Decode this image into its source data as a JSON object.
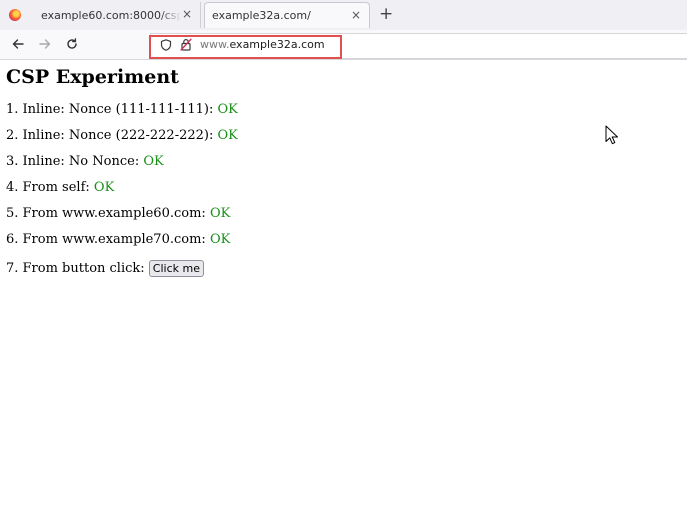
{
  "browser": {
    "tabs": [
      {
        "title": "example60.com:8000/cspte",
        "close_label": "×",
        "active": false
      },
      {
        "title": "example32a.com/",
        "close_label": "×",
        "active": true
      }
    ],
    "new_tab_label": "+",
    "address_bar": {
      "url_prefix": "www.",
      "url_domain": "example32a.com"
    }
  },
  "page": {
    "title": "CSP Experiment",
    "tests": [
      {
        "label": "1. Inline: Nonce (111-111-111): ",
        "status": "OK"
      },
      {
        "label": "2. Inline: Nonce (222-222-222): ",
        "status": "OK"
      },
      {
        "label": "3. Inline: No Nonce: ",
        "status": "OK"
      },
      {
        "label": "4. From self: ",
        "status": "OK"
      },
      {
        "label": "5. From www.example60.com: ",
        "status": "OK"
      },
      {
        "label": "6. From www.example70.com: ",
        "status": "OK"
      }
    ],
    "button_test": {
      "label": "7. From button click: ",
      "button_label": "Click me"
    }
  },
  "colors": {
    "ok_status": "#1a8f1a",
    "highlight_box": "#e05050"
  }
}
